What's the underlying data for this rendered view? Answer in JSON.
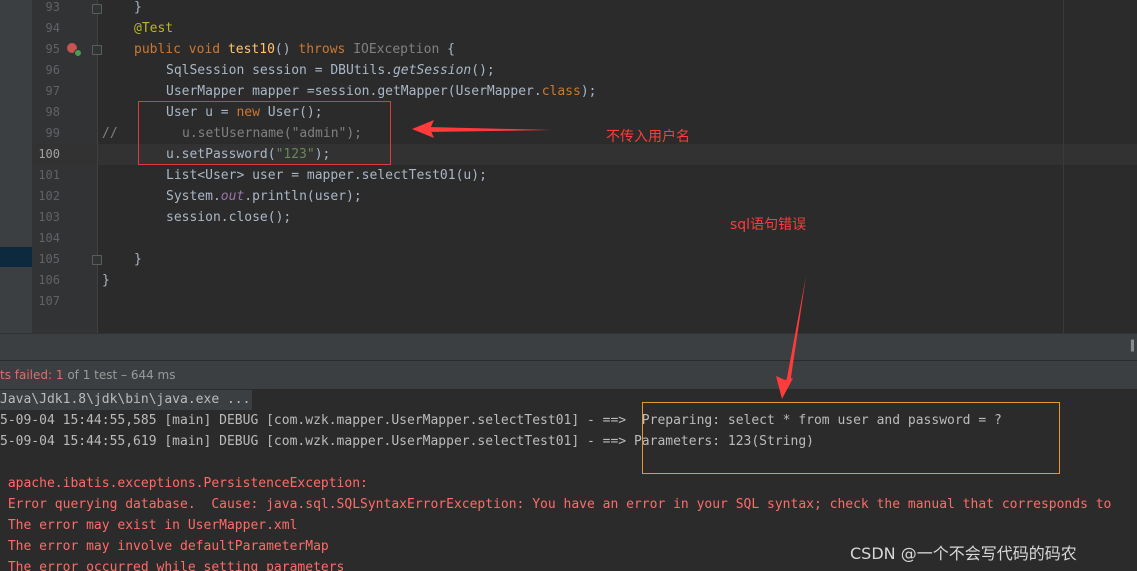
{
  "editor": {
    "line_numbers": [
      "93",
      "94",
      "95",
      "96",
      "97",
      "98",
      "99",
      "100",
      "101",
      "102",
      "103",
      "104",
      "105",
      "106",
      "107"
    ],
    "current_line": "100",
    "lines": {
      "l93": "}",
      "l94_annotation": "@Test",
      "l95_public": "public",
      "l95_void": "void",
      "l95_method": "test10",
      "l95_parens": "() ",
      "l95_throws": "throws",
      "l95_exception": "IOException",
      "l95_brace": " {",
      "l96_a": "SqlSession session = DBUtils.",
      "l96_call": "getSession",
      "l96_b": "();",
      "l97_a": "UserMapper mapper =session.getMapper(UserMapper.",
      "l97_class": "class",
      "l97_b": ");",
      "l98_a": "User u = ",
      "l98_new": "new",
      "l98_b": " User();",
      "l99_comment_prefix": "//",
      "l99_code": "u.setUsername(\"admin\");",
      "l100_a": "u.setPassword(",
      "l100_str": "\"123\"",
      "l100_b": ");",
      "l101": "List<User> user = mapper.selectTest01(u);",
      "l102_a": "System.",
      "l102_out": "out",
      "l102_b": ".println(user);",
      "l103": "session.close();",
      "l105": "}",
      "l106": "}"
    }
  },
  "annotations": {
    "no_username": "不传入用户名",
    "sql_error": "sql语句错误"
  },
  "status": {
    "failed_label": "ts failed: 1",
    "rest_label": " of 1 test – 644 ms"
  },
  "console": {
    "lines": [
      "Java\\Jdk1.8\\jdk\\bin\\java.exe ...",
      "5-09-04 15:44:55,585 [main] DEBUG [com.wzk.mapper.UserMapper.selectTest01] - ==>  Preparing: select * from user and password = ?",
      "5-09-04 15:44:55,619 [main] DEBUG [com.wzk.mapper.UserMapper.selectTest01] - ==> Parameters: 123(String)",
      "",
      " apache.ibatis.exceptions.PersistenceException:",
      " Error querying database.  Cause: java.sql.SQLSyntaxErrorException: You have an error in your SQL syntax; check the manual that corresponds to",
      " The error may exist in UserMapper.xml",
      " The error may involve defaultParameterMap",
      " The error occurred while setting parameters"
    ]
  },
  "watermark": "CSDN @一个不会写代码的码农",
  "colors": {
    "keyword": "#cc7832",
    "annotation": "#bbb529",
    "method": "#ffc66d",
    "string": "#6a8759",
    "error_text": "#ff6b68",
    "red_annotation": "#ff3b3b",
    "orange_box": "#e8962e"
  }
}
